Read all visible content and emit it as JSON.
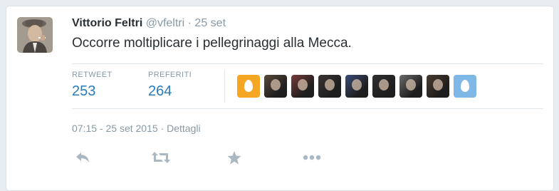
{
  "tweet": {
    "author_name": "Vittorio Feltri",
    "author_handle": "@vfeltri",
    "separator": "·",
    "date_short": "25 set",
    "text": "Occorre moltiplicare i pellegrinaggi alla Mecca."
  },
  "stats": {
    "retweets_label": "RETWEET",
    "retweets_value": "253",
    "favorites_label": "PREFERITI",
    "favorites_value": "264"
  },
  "favoriters": [
    {
      "kind": "egg",
      "color": "#f5a623"
    },
    {
      "kind": "photo",
      "color": "#5a4a3a"
    },
    {
      "kind": "photo",
      "color": "#7a3b3b"
    },
    {
      "kind": "photo",
      "color": "#3a3433"
    },
    {
      "kind": "photo",
      "color": "#3b4c7a"
    },
    {
      "kind": "photo",
      "color": "#2f2f2f"
    },
    {
      "kind": "photo",
      "color": "#6c6c6c"
    },
    {
      "kind": "photo",
      "color": "#4a3b2f"
    },
    {
      "kind": "egg",
      "color": "#7fb8e6"
    }
  ],
  "timestamp": {
    "text": "07:15 - 25 set 2015",
    "separator": "·",
    "details_label": "Dettagli"
  },
  "actions": {
    "reply_icon": "reply-icon",
    "retweet_icon": "retweet-icon",
    "favorite_icon": "star-icon",
    "more_icon": "more-icon",
    "icon_color": "#aab8c2"
  },
  "colors": {
    "link": "#2b7bb9",
    "muted": "#8899a6",
    "text": "#292f33"
  }
}
